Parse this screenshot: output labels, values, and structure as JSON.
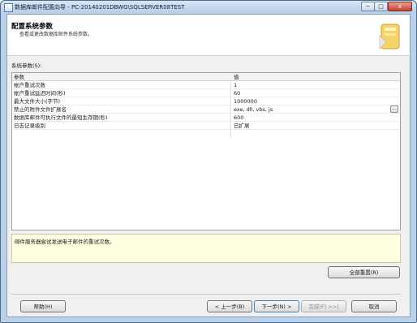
{
  "window": {
    "title": "数据库邮件配置向导 - PC-20140201DBWG\\SQLSERVER08TEST",
    "minimize": "─",
    "maximize": "□",
    "close": "x"
  },
  "header": {
    "title": "配置系统参数",
    "subtitle": "查看或更改数据库邮件系统参数。"
  },
  "section_label": "系统参数(S):",
  "grid": {
    "columns": [
      "参数",
      "值"
    ],
    "rows": [
      {
        "param": "帐户重试次数",
        "value": "1"
      },
      {
        "param": "帐户重试延迟时间(秒)",
        "value": "60"
      },
      {
        "param": "最大文件大小(字节)",
        "value": "1000000"
      },
      {
        "param": "禁止的附件文件扩展名",
        "value": "exe, dll, vbs, js"
      },
      {
        "param": "数据库邮件可执行文件的最短生存期(秒)",
        "value": "600"
      },
      {
        "param": "日志记录级别",
        "value": "已扩展"
      }
    ],
    "ellipsis_label": "..."
  },
  "description": "邮件服务器尝试发送电子邮件的重试次数。",
  "buttons": {
    "reset_all": "全部重置(R)",
    "help": "帮助(H)",
    "back": "< 上一步(B)",
    "next": "下一步(N) >",
    "finish": "完成(F) >>|",
    "cancel": "取消"
  }
}
